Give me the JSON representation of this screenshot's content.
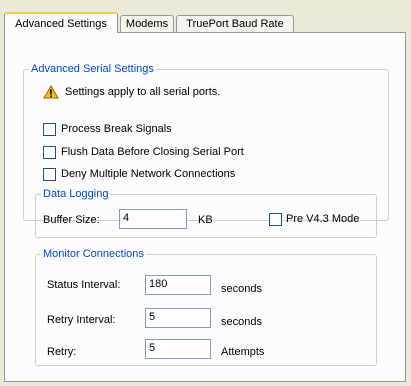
{
  "tabs": [
    {
      "label": "Advanced Settings",
      "active": true
    },
    {
      "label": "Modems",
      "active": false
    },
    {
      "label": "TruePort Baud Rate",
      "active": false
    }
  ],
  "serial": {
    "legend": "Advanced Serial Settings",
    "warning": "Settings apply to all serial ports.",
    "options": [
      {
        "label": "Process Break Signals",
        "checked": false
      },
      {
        "label": "Flush Data Before Closing Serial Port",
        "checked": false
      },
      {
        "label": "Deny Multiple Network Connections",
        "checked": false
      }
    ]
  },
  "logging": {
    "legend": "Data Logging",
    "buffer_label": "Buffer Size:",
    "buffer_value": "4",
    "buffer_unit": "KB",
    "prev43_label": "Pre V4.3 Mode",
    "prev43_checked": false
  },
  "monitor": {
    "legend": "Monitor Connections",
    "rows": [
      {
        "label": "Status Interval:",
        "value": "180",
        "unit": "seconds"
      },
      {
        "label": "Retry Interval:",
        "value": "5",
        "unit": "seconds"
      },
      {
        "label": "Retry:",
        "value": "5",
        "unit": "Attempts"
      }
    ]
  },
  "colors": {
    "group_title": "#0046d5",
    "warning_icon": "#f5c400",
    "tab_highlight": "#ffc83c"
  },
  "icons": {
    "warning": "warning-triangle-icon"
  }
}
